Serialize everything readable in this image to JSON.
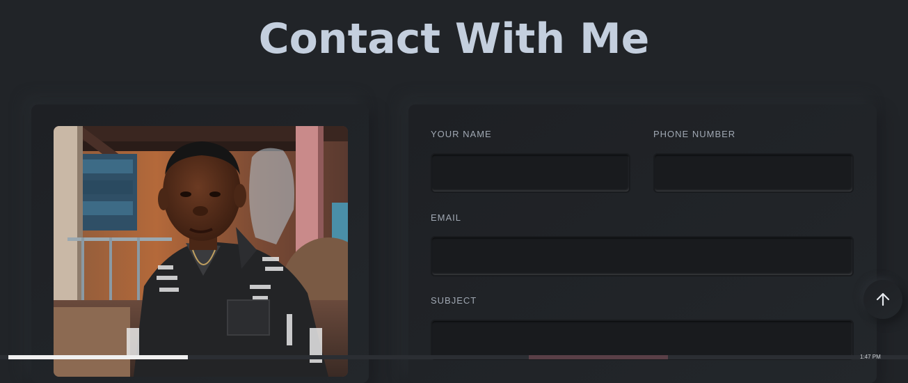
{
  "header": {
    "title": "Contact With Me"
  },
  "form": {
    "name_label": "YOUR NAME",
    "name_value": "",
    "phone_label": "PHONE NUMBER",
    "phone_value": "",
    "email_label": "EMAIL",
    "email_value": "",
    "subject_label": "SUBJECT",
    "subject_value": ""
  },
  "controls": {
    "scroll_top_icon": "arrow-up-icon"
  },
  "taskbar": {
    "clock": "1:47 PM"
  },
  "colors": {
    "background": "#212428",
    "title": "#c4cfde",
    "label": "#a0a8b3",
    "input_bg": "#191b1e"
  }
}
